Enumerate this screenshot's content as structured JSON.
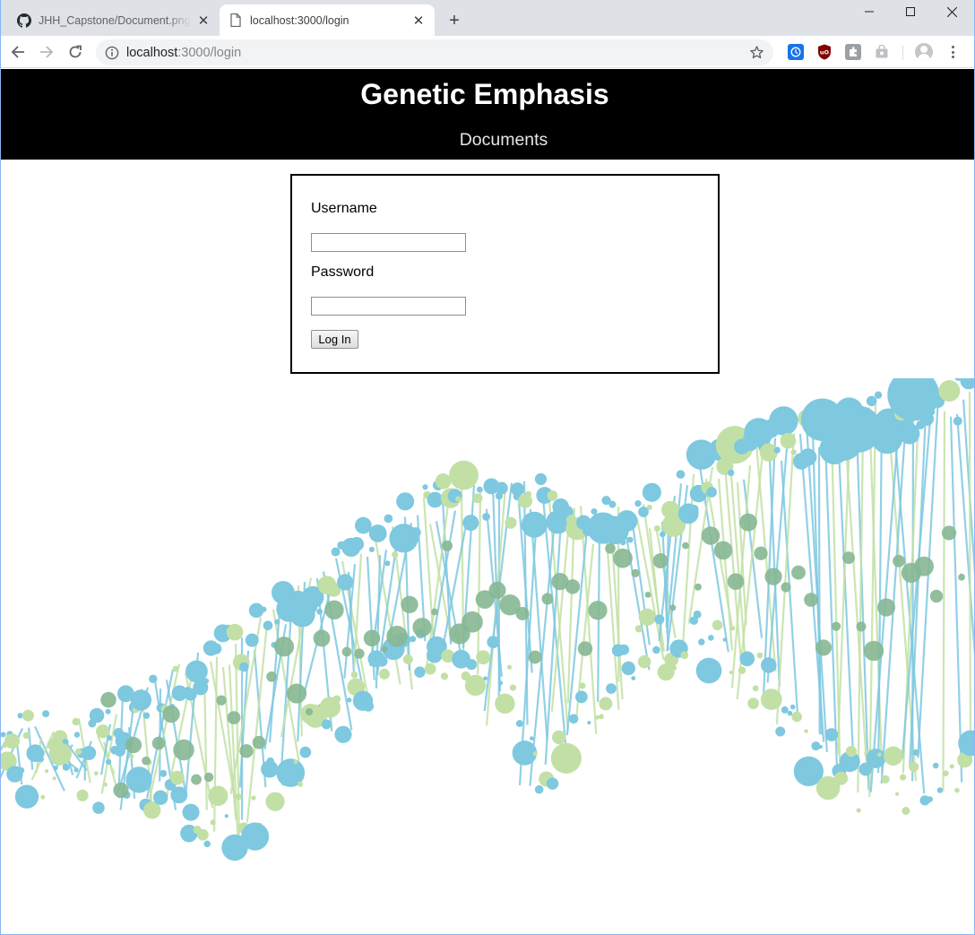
{
  "browser": {
    "tabs": [
      {
        "title": "JHH_Capstone/Document.png at",
        "favicon": "github-icon",
        "active": false
      },
      {
        "title": "localhost:3000/login",
        "favicon": "page-icon",
        "active": true
      }
    ],
    "address": {
      "host": "localhost",
      "path": ":3000/login"
    },
    "window_controls": [
      "minimize-icon",
      "maximize-icon",
      "close-icon"
    ],
    "extensions": [
      {
        "name": "clock-extension-icon",
        "color": "#1a73e8"
      },
      {
        "name": "ublock-extension-icon",
        "color": "#800000"
      },
      {
        "name": "puzzle-extension-icon",
        "color": "#9aa0a6"
      },
      {
        "name": "bag-extension-icon",
        "color": "#bdc1c6"
      }
    ]
  },
  "site": {
    "title": "Genetic Emphasis",
    "nav": "Documents",
    "header_bg": "#000000"
  },
  "login": {
    "username_label": "Username",
    "username_value": "",
    "password_label": "Password",
    "password_value": "",
    "submit_label": "Log In"
  },
  "illustration": {
    "name": "dna-helix-graphic",
    "colors": {
      "blue": "#7ec8e0",
      "green": "#c2e0a6",
      "overlap": "#86b793"
    }
  }
}
